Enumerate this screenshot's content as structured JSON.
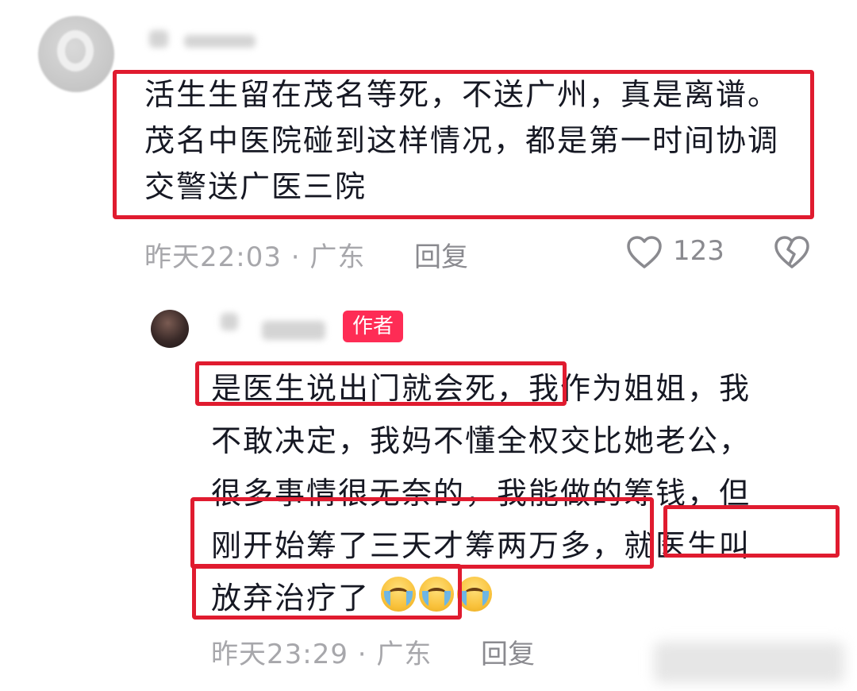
{
  "comments": [
    {
      "text": "活生生留在茂名等死，不送广州，真是离谱。茂名中医院碰到这样情况，都是第一时间协调交警送广医三院",
      "time_location": "昨天22:03 · 广东",
      "reply_label": "回复",
      "like_count": "123"
    }
  ],
  "reply": {
    "author_badge": "作者",
    "text_line1": "是医生说出门就会死，我作为姐姐，我",
    "text_line2": "不敢决定，我妈不懂全权交比她老公，",
    "text_line3": "很多事情很无奈的，我能做的筹钱，但",
    "text_line4": "刚开始筹了三天才筹两万多，就医生叫",
    "text_line5": "放弃治疗了",
    "emojis": [
      "crying-face-emoji",
      "crying-face-emoji",
      "crying-face-emoji"
    ],
    "time_location": "昨天23:29 · 广东",
    "reply_label": "回复"
  },
  "colors": {
    "highlight_box": "#e01b2f",
    "author_badge": "#fe2c55",
    "meta_text": "#a7a7ab"
  },
  "icons": [
    "heart-outline-icon",
    "broken-heart-icon"
  ]
}
